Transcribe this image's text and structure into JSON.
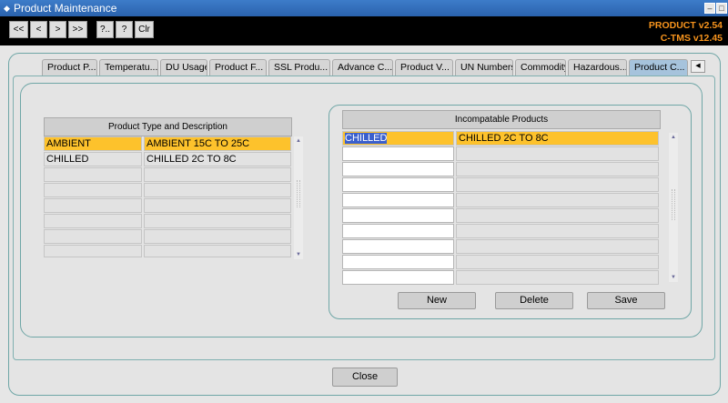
{
  "window": {
    "title": "Product Maintenance",
    "icon": "app-icon"
  },
  "toolbar": {
    "buttons": [
      {
        "label": "<<"
      },
      {
        "label": "<"
      },
      {
        "label": ">"
      },
      {
        "label": ">>"
      },
      {
        "label": "?.."
      },
      {
        "label": "?"
      },
      {
        "label": "Clr"
      }
    ],
    "version_line1": "PRODUCT v2.54",
    "version_line2": "C-TMS v12.45",
    "version_color": "#f7941d"
  },
  "tabs": [
    {
      "label": "Product P..."
    },
    {
      "label": "Temperatu..."
    },
    {
      "label": "DU Usage"
    },
    {
      "label": "Product F..."
    },
    {
      "label": "SSL Produ..."
    },
    {
      "label": "Advance C..."
    },
    {
      "label": "Product V..."
    },
    {
      "label": "UN Numbers"
    },
    {
      "label": "Commodity"
    },
    {
      "label": "Hazardous..."
    },
    {
      "label": "Product C..."
    }
  ],
  "active_tab_index": 10,
  "product_types": {
    "header": "Product Type and Description",
    "rows": [
      {
        "code": "AMBIENT",
        "description": "AMBIENT 15C TO 25C",
        "selected": true
      },
      {
        "code": "CHILLED",
        "description": "CHILLED 2C TO 8C",
        "selected": false
      }
    ]
  },
  "incompatible_products": {
    "header": "Incompatable Products",
    "rows": [
      {
        "code": "CHILLED",
        "description": "CHILLED 2C TO 8C",
        "selected": true
      }
    ]
  },
  "actions": {
    "new": "New",
    "delete": "Delete",
    "save": "Save"
  },
  "close_label": "Close",
  "highlight_color": "#fdc22c"
}
